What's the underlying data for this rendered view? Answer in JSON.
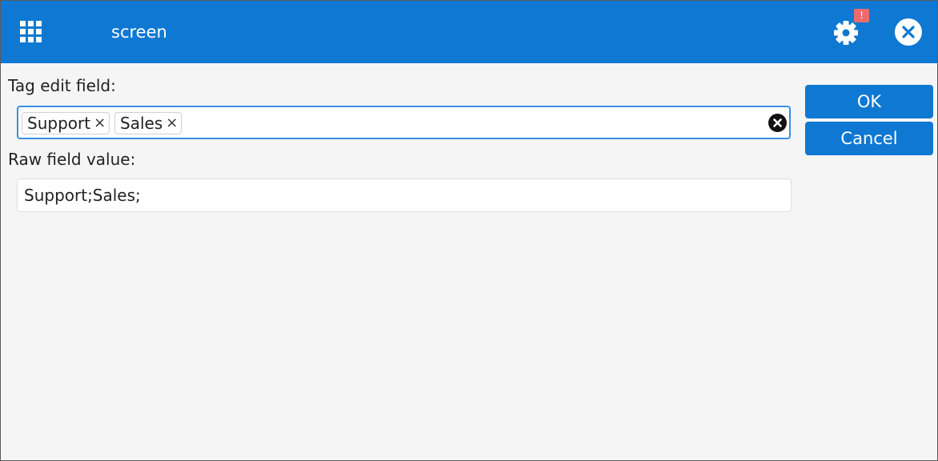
{
  "titlebar": {
    "title": "screen",
    "apps_icon": "grid-icon",
    "settings_icon": "gear-icon",
    "settings_badge": "!",
    "close_icon": "close-icon",
    "color": "#0f78d3"
  },
  "tag_field": {
    "label": "Tag edit field:",
    "tags": [
      {
        "label": "Support",
        "remove": "×"
      },
      {
        "label": "Sales",
        "remove": "×"
      }
    ],
    "clear_icon": "clear-icon"
  },
  "raw_field": {
    "label": "Raw field value:",
    "value": "Support;Sales;"
  },
  "buttons": {
    "ok": "OK",
    "cancel": "Cancel"
  }
}
